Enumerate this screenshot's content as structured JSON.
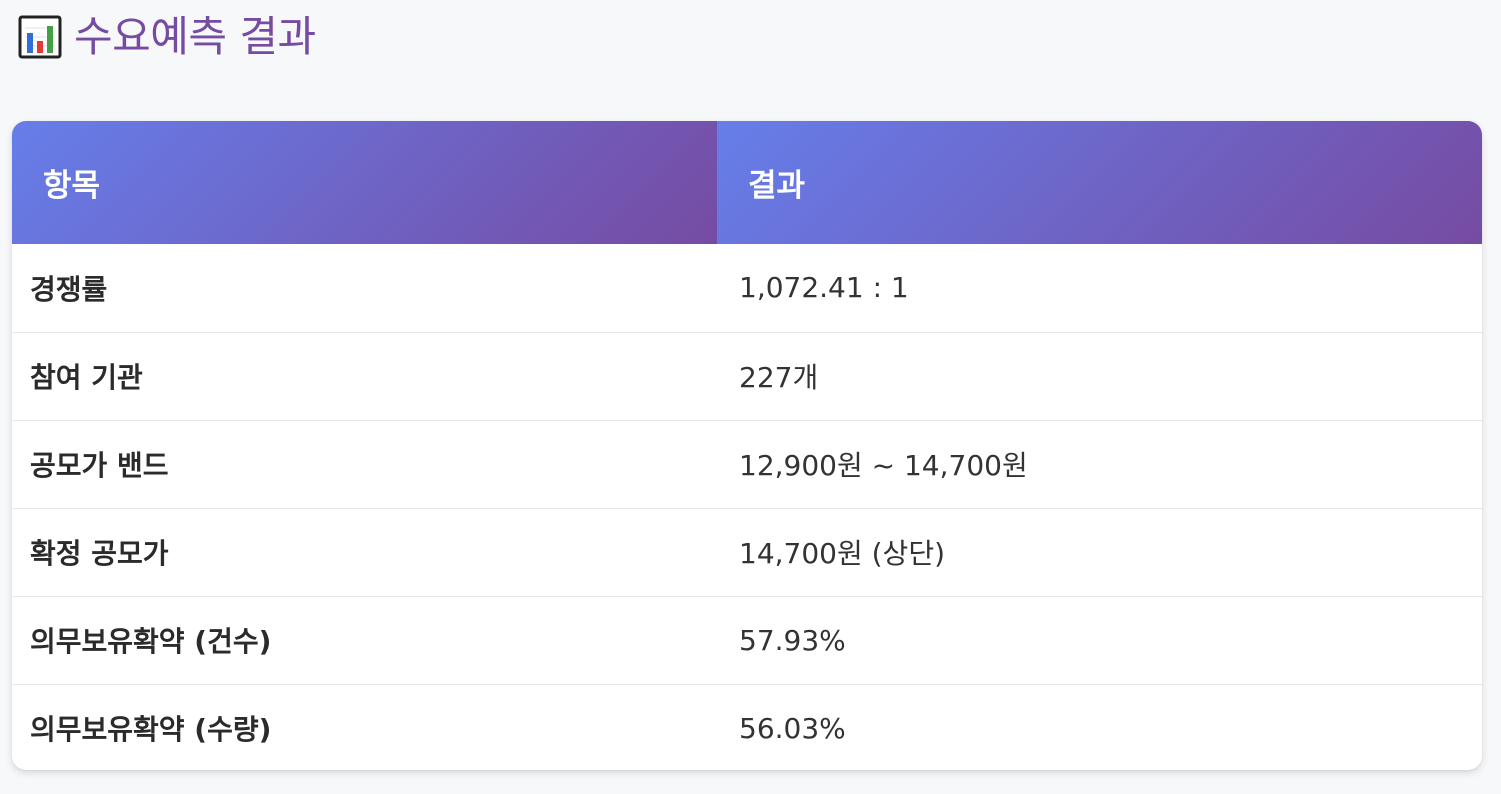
{
  "header": {
    "icon": "bar-chart-icon",
    "title": "수요예측 결과"
  },
  "table": {
    "columns": [
      "항목",
      "결과"
    ],
    "rows": [
      {
        "item": "경쟁률",
        "result": "1,072.41 : 1"
      },
      {
        "item": "참여 기관",
        "result": "227개"
      },
      {
        "item": "공모가 밴드",
        "result": "12,900원 ~ 14,700원"
      },
      {
        "item": "확정 공모가",
        "result": "14,700원 (상단)"
      },
      {
        "item": "의무보유확약 (건수)",
        "result": "57.93%"
      },
      {
        "item": "의무보유확약 (수량)",
        "result": "56.03%"
      }
    ]
  },
  "colors": {
    "title": "#764ba2",
    "header_gradient_start": "#667eea",
    "header_gradient_end": "#764ba2",
    "background": "#f7f8fa",
    "card": "#ffffff"
  }
}
